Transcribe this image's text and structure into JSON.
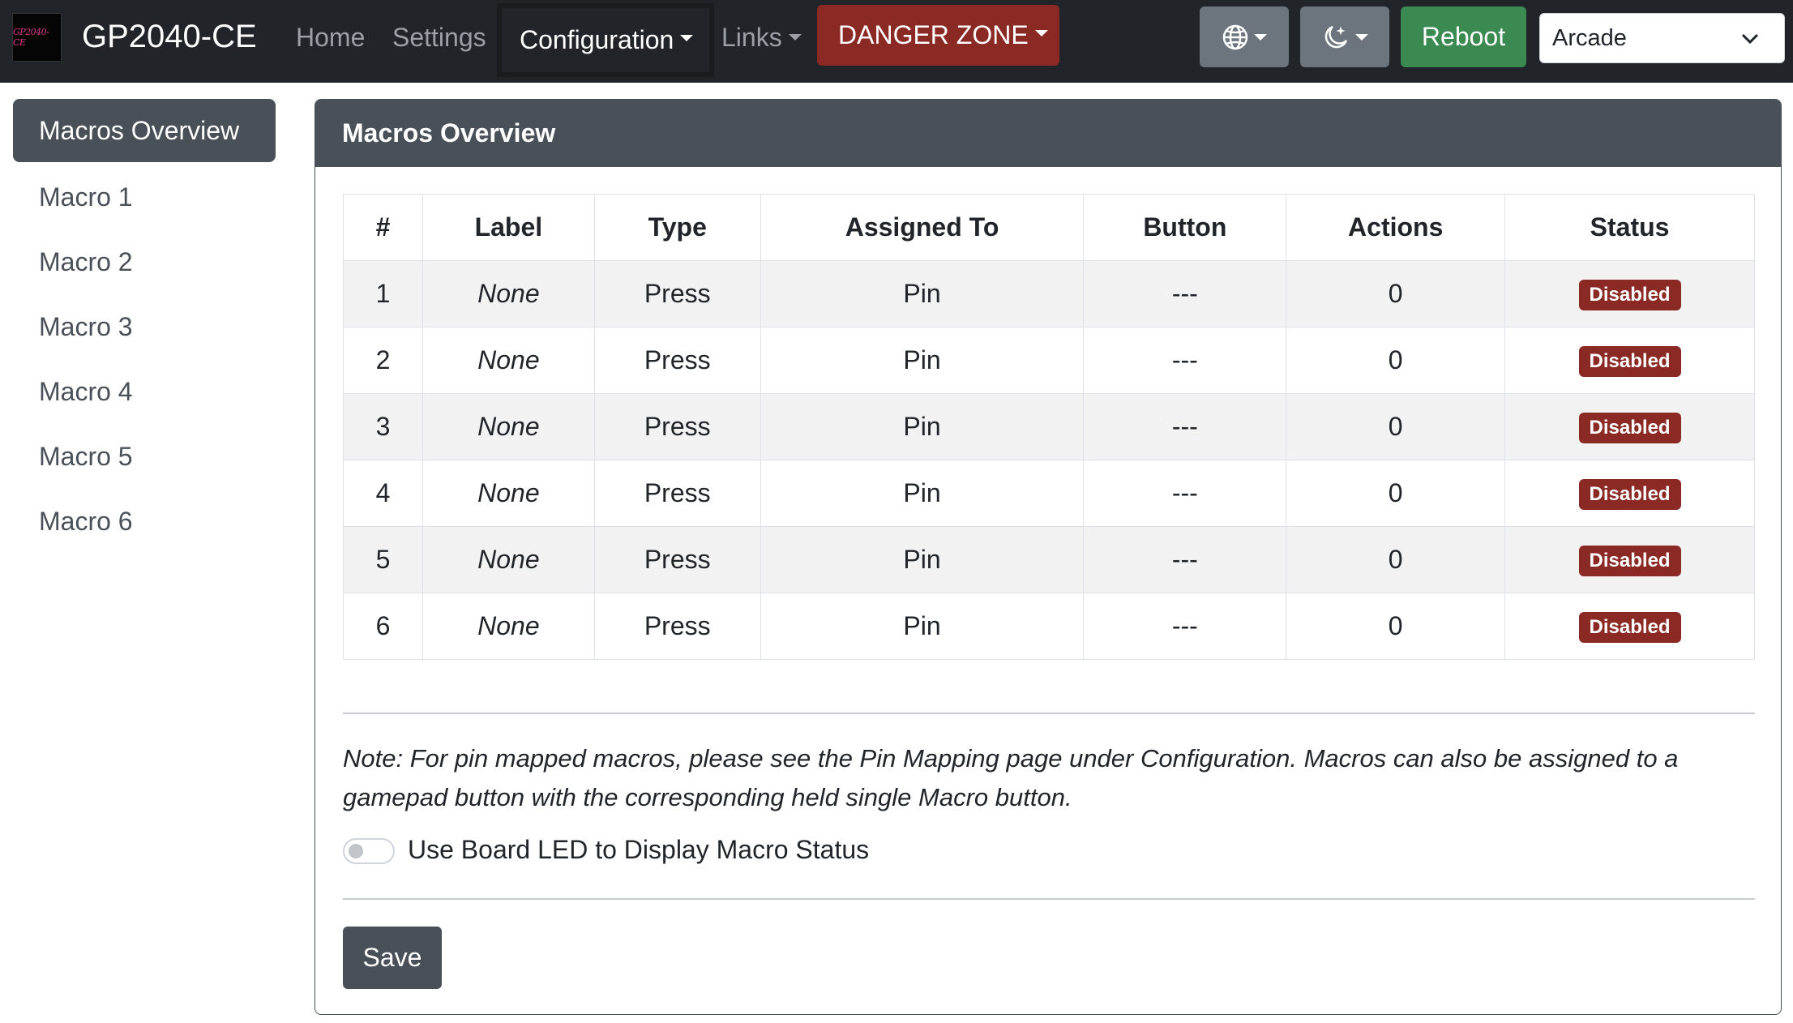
{
  "navbar": {
    "logo_text": "GP2040-CE",
    "brand": "GP2040-CE",
    "home": "Home",
    "settings": "Settings",
    "configuration": "Configuration",
    "links": "Links",
    "danger_zone": "DANGER ZONE",
    "language_icon": "globe-icon",
    "theme_icon": "moon-stars-icon",
    "reboot": "Reboot",
    "mode_select": "Arcade"
  },
  "sidebar": {
    "items": [
      {
        "label": "Macros Overview",
        "active": true
      },
      {
        "label": "Macro 1"
      },
      {
        "label": "Macro 2"
      },
      {
        "label": "Macro 3"
      },
      {
        "label": "Macro 4"
      },
      {
        "label": "Macro 5"
      },
      {
        "label": "Macro 6"
      }
    ]
  },
  "main": {
    "title": "Macros Overview",
    "table": {
      "headers": [
        "#",
        "Label",
        "Type",
        "Assigned To",
        "Button",
        "Actions",
        "Status"
      ],
      "rows": [
        {
          "num": "1",
          "label": "None",
          "type": "Press",
          "assigned": "Pin",
          "button": "---",
          "actions": "0",
          "status": "Disabled"
        },
        {
          "num": "2",
          "label": "None",
          "type": "Press",
          "assigned": "Pin",
          "button": "---",
          "actions": "0",
          "status": "Disabled"
        },
        {
          "num": "3",
          "label": "None",
          "type": "Press",
          "assigned": "Pin",
          "button": "---",
          "actions": "0",
          "status": "Disabled"
        },
        {
          "num": "4",
          "label": "None",
          "type": "Press",
          "assigned": "Pin",
          "button": "---",
          "actions": "0",
          "status": "Disabled"
        },
        {
          "num": "5",
          "label": "None",
          "type": "Press",
          "assigned": "Pin",
          "button": "---",
          "actions": "0",
          "status": "Disabled"
        },
        {
          "num": "6",
          "label": "None",
          "type": "Press",
          "assigned": "Pin",
          "button": "---",
          "actions": "0",
          "status": "Disabled"
        }
      ]
    },
    "note": "Note: For pin mapped macros, please see the Pin Mapping page under Configuration. Macros can also be assigned to a gamepad button with the corresponding held single Macro button.",
    "toggle_label": "Use Board LED to Display Macro Status",
    "toggle_on": false,
    "save": "Save"
  },
  "colors": {
    "navbar_bg": "#212529",
    "danger": "#8b2a24",
    "reboot": "#3a8a52",
    "header_bg": "#495057"
  }
}
